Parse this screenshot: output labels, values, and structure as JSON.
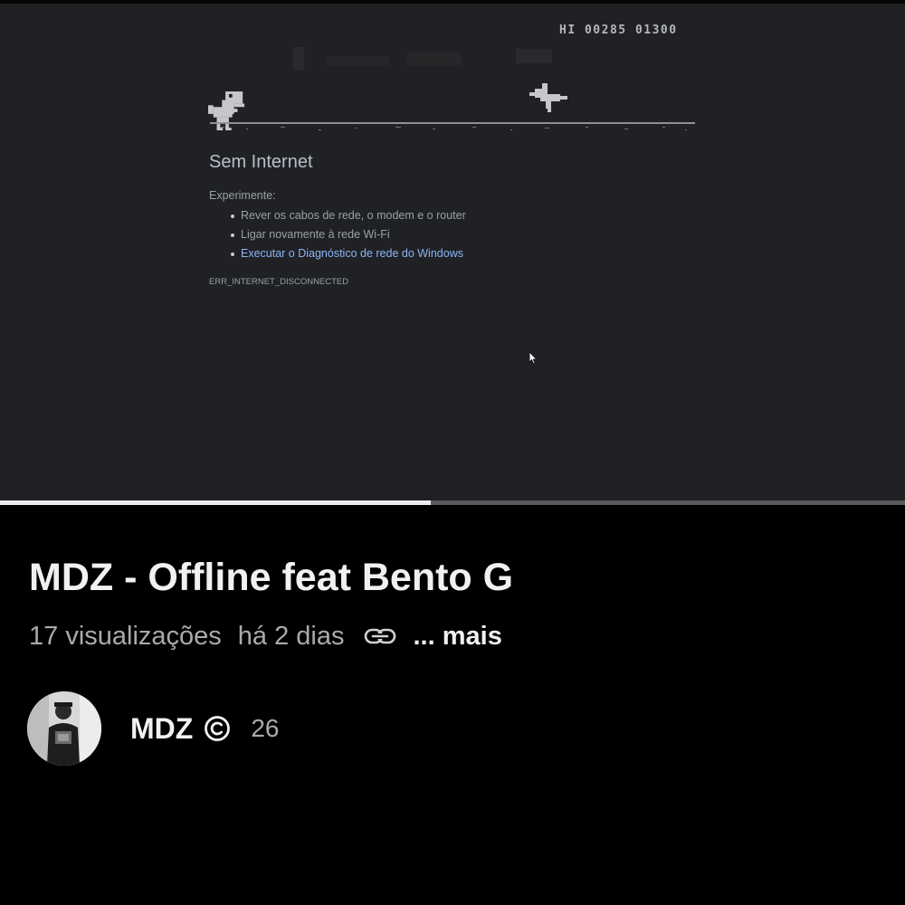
{
  "video_frame": {
    "game_score": "HI 00285 01300",
    "error_title": "Sem Internet",
    "try_label": "Experimente:",
    "suggestions": [
      "Rever os cabos de rede, o modem e o router",
      "Ligar novamente à rede Wi-Fi",
      "Executar o Diagnóstico de rede do Windows"
    ],
    "error_code": "ERR_INTERNET_DISCONNECTED"
  },
  "player": {
    "progress_fraction": 0.476
  },
  "video": {
    "title": "MDZ - Offline feat Bento G",
    "views": "17 visualizações",
    "posted": "há 2 dias",
    "more_label": "... mais"
  },
  "channel": {
    "name": "MDZ",
    "subscribers": "26"
  },
  "icons": {
    "link": "link-icon",
    "channel_badge": "copyright-circle-icon"
  },
  "colors": {
    "frame_bg": "#202124",
    "link_blue": "#8ab4f8",
    "progress_played": "#ececec"
  }
}
